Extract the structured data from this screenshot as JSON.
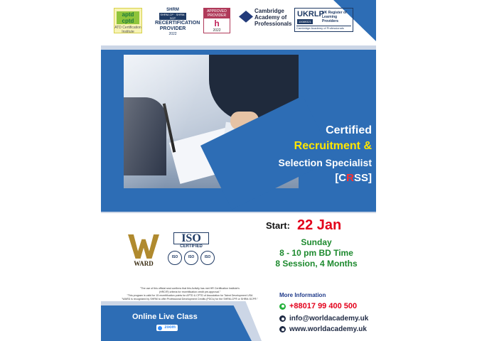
{
  "logos": {
    "aptd": {
      "line1": "aptd cptd",
      "line2": "ATD Certification Institute"
    },
    "shrm": {
      "top": "SHRM",
      "band": "SHRM-CP · SHRM-SCP",
      "word1": "RECERTIFICATION",
      "word2": "PROVIDER",
      "year": "2022"
    },
    "hrci": {
      "top": "APPROVED PROVIDER",
      "mark": "h",
      "year": "2022"
    },
    "cambridge": {
      "text": "Cambridge Academy of Professionals"
    },
    "ukrlp": {
      "name": "UKRLP",
      "id": "10089321",
      "desc": "UK Register of Learning Providers",
      "footer": "Cambridge Academy of Professionals"
    }
  },
  "course": {
    "line1": "Certified",
    "line2": "Recruitment &",
    "line3": "Selection Specialist",
    "code_open": "[C",
    "code_highlight": "R",
    "code_close": "SS]"
  },
  "accreditation": {
    "ward": "WARD",
    "iso_word": "ISO",
    "iso_certified": "CERTIFIED",
    "iso_seals": [
      "ISO",
      "ISO",
      "ISO"
    ]
  },
  "schedule": {
    "start_label": "Start:",
    "start_date": "22 Jan",
    "day": "Sunday",
    "time": "8 - 10 pm BD Time",
    "sessions": "8 Session, 4 Months"
  },
  "fine_print": [
    "\"The use of this official seal confirms that this Activity has met HR Certification Institute's",
    "(HRCI®) criteria for recertification credit pre-approval.\"",
    "\"This program is valid for 15 recertification points for APTD & CPTD of Association for Talent Development USA",
    "\"WARD is recognized by SHRM to offer Professional Development Credits (PDCs) for the SHRM-CP® or SHRM-SCP®.\""
  ],
  "footer": {
    "online": "Online Live Class",
    "zoom": "zoom",
    "more_info": "More Information",
    "phone": "+88017 99 400 500",
    "email": "info@worldacademy.uk",
    "website": "www.worldacademy.uk"
  },
  "colors": {
    "brand_blue": "#2d6db5",
    "accent_yellow": "#ffe600",
    "accent_red": "#e3001b",
    "accent_green": "#1d8a2e"
  }
}
